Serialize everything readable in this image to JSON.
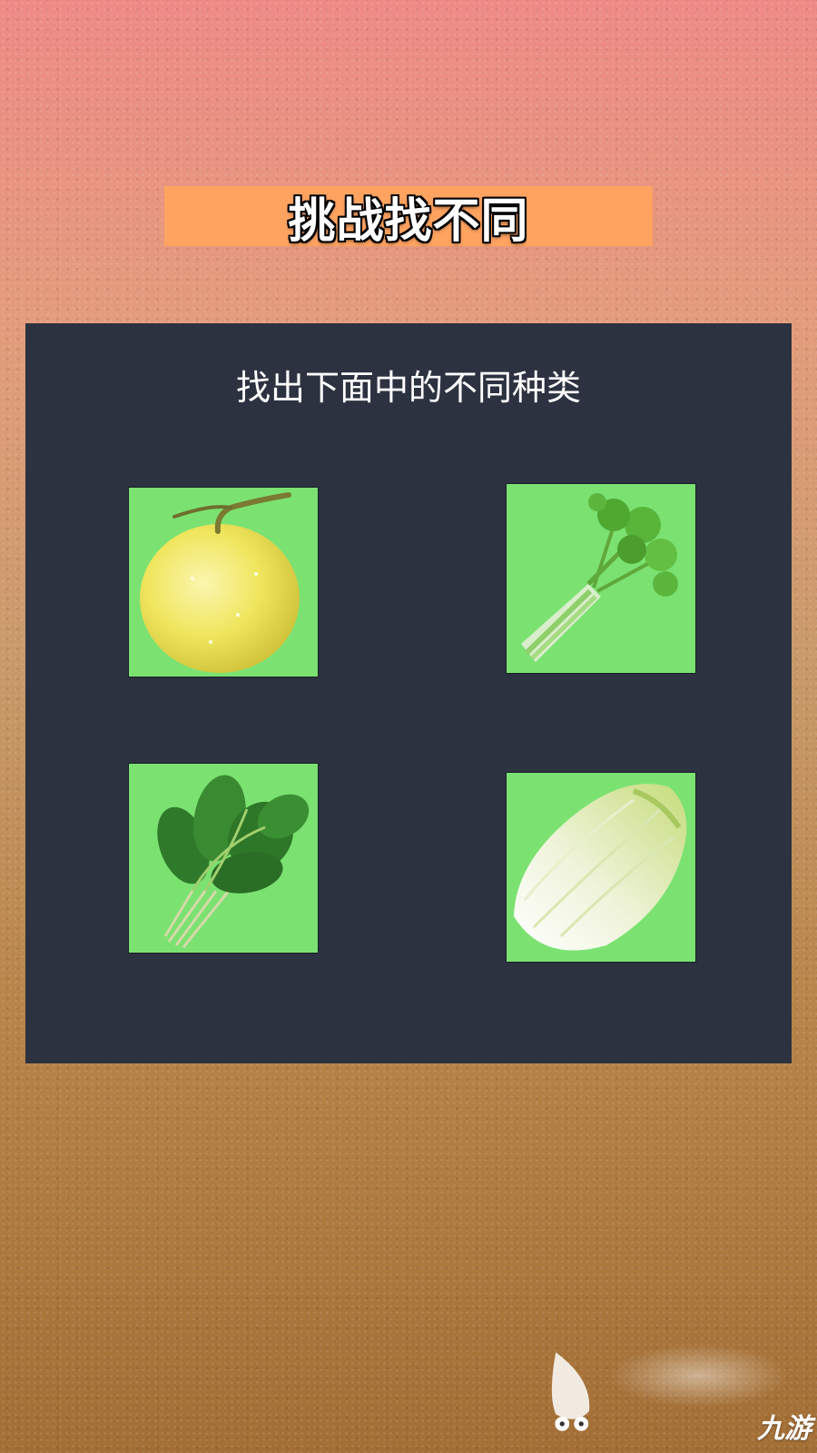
{
  "game": {
    "title": "挑战找不同",
    "instruction": "找出下面中的不同种类"
  },
  "choices": [
    {
      "name": "yellow-melon",
      "icon": "melon-icon"
    },
    {
      "name": "celery",
      "icon": "celery-icon"
    },
    {
      "name": "spinach",
      "icon": "spinach-icon"
    },
    {
      "name": "napa-cabbage",
      "icon": "cabbage-icon"
    }
  ],
  "watermark": {
    "brand": "九游"
  },
  "colors": {
    "title_bg": "#ffa360",
    "panel_bg": "#2c3240",
    "card_bg": "#7be272"
  }
}
